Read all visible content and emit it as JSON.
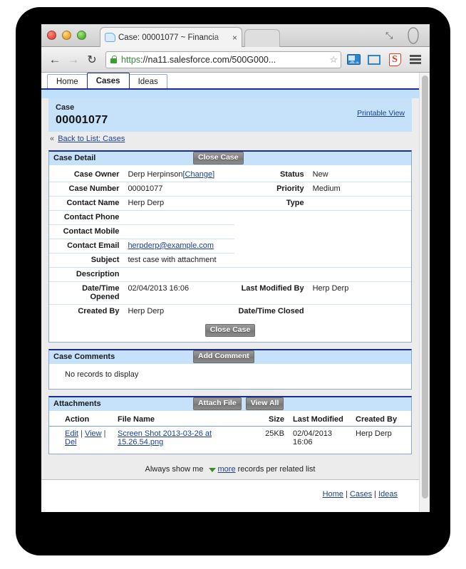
{
  "browser": {
    "tab_title": "Case: 00001077 ~ Financia",
    "tab_close": "×",
    "back_icon": "←",
    "forward_icon": "→",
    "reload_icon": "↻",
    "expand_icon": "⤡",
    "url_scheme": "https",
    "url_rest": "://na11.salesforce.com/500G000...",
    "star_icon": "☆",
    "extensions": [
      "photo-icon",
      "screen-capture-icon",
      "skitch-icon",
      "chrome-menu-icon"
    ],
    "skitch_letter": "S"
  },
  "sf_tabs": [
    {
      "label": "Home",
      "active": false
    },
    {
      "label": "Cases",
      "active": true
    },
    {
      "label": "Ideas",
      "active": false
    }
  ],
  "case_header": {
    "kind": "Case",
    "number": "00001077",
    "printable_view": "Printable View",
    "back_chevron": "«",
    "back_link": "Back to List: Cases"
  },
  "case_detail": {
    "title": "Case Detail",
    "close_button": "Close Case",
    "rows": [
      {
        "label": "Case Owner",
        "value": "Derp Herpinson",
        "link": "[Change]",
        "label2": "Status",
        "value2": "New"
      },
      {
        "label": "Case Number",
        "value": "00001077",
        "label2": "Priority",
        "value2": "Medium"
      },
      {
        "label": "Contact Name",
        "value": "Herp Derp",
        "label2": "Type",
        "value2": ""
      },
      {
        "label": "Contact Phone",
        "value": "",
        "label2": "",
        "value2": ""
      },
      {
        "label": "Contact Mobile",
        "value": "",
        "label2": "",
        "value2": ""
      },
      {
        "label": "Contact Email",
        "value": "",
        "email": "herpderp@example.com",
        "label2": "",
        "value2": ""
      },
      {
        "label": "Subject",
        "value": "test case with attachment",
        "label2": "",
        "value2": ""
      },
      {
        "label": "Description",
        "value": "",
        "label2": "",
        "value2": ""
      },
      {
        "label": "Date/Time Opened",
        "value": "02/04/2013 16:06",
        "label2": "Last Modified By",
        "value2": "Herp Derp"
      },
      {
        "label": "Created By",
        "value": "Herp Derp",
        "label2": "Date/Time Closed",
        "value2": ""
      }
    ]
  },
  "case_comments": {
    "title": "Case Comments",
    "add_button": "Add Comment",
    "empty_text": "No records to display"
  },
  "attachments": {
    "title": "Attachments",
    "attach_button": "Attach File",
    "view_all_button": "View All",
    "columns": [
      "Action",
      "File Name",
      "Size",
      "Last Modified",
      "Created By"
    ],
    "rows": [
      {
        "edit": "Edit",
        "view": "View",
        "del": "Del",
        "file_name": "Screen Shot 2013-03-26 at 15.26.54.png",
        "size": "25KB",
        "last_modified": "02/04/2013 16:06",
        "created_by": "Herp Derp"
      }
    ]
  },
  "footer": {
    "always_prefix": "Always show me",
    "more_link": "more",
    "always_suffix": "records per related list",
    "links": [
      "Home",
      "Cases",
      "Ideas"
    ],
    "link_sep": "|"
  }
}
